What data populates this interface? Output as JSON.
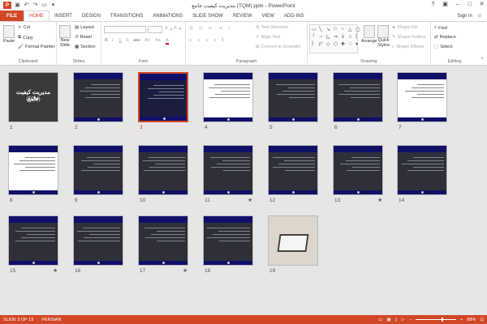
{
  "window": {
    "title": "مدیریت کیفیت جامع (TQM).pptx - PowerPoint"
  },
  "tabs": [
    "FILE",
    "HOME",
    "INSERT",
    "DESIGN",
    "TRANSITIONS",
    "ANIMATIONS",
    "SLIDE SHOW",
    "REVIEW",
    "VIEW",
    "ADD-INS"
  ],
  "active_tab": "HOME",
  "signin": "Sign in",
  "ribbon": {
    "clipboard": {
      "label": "Clipboard",
      "paste": "Paste",
      "cut": "Cut",
      "copy": "Copy",
      "format_painter": "Format Painter"
    },
    "slides": {
      "label": "Slides",
      "new_slide": "New",
      "new_slide2": "Slide",
      "layout": "Layout",
      "reset": "Reset",
      "section": "Section"
    },
    "font": {
      "label": "Font"
    },
    "paragraph": {
      "label": "Paragraph",
      "text_direction": "Text Direction",
      "align_text": "Align Text",
      "convert": "Convert to SmartArt"
    },
    "drawing": {
      "label": "Drawing",
      "arrange": "Arrange",
      "quick_styles": "Quick",
      "quick_styles2": "Styles",
      "shape_fill": "Shape Fill",
      "shape_outline": "Shape Outline",
      "shape_effects": "Shape Effects"
    },
    "editing": {
      "label": "Editing",
      "find": "Find",
      "replace": "Replace",
      "select": "Select"
    }
  },
  "slides": [
    {
      "num": "1",
      "title": "مدیریت کیفیت جامع",
      "subtitle": "(TQM)",
      "star": false
    },
    {
      "num": "2",
      "star": false
    },
    {
      "num": "3",
      "star": false,
      "selected": true
    },
    {
      "num": "4",
      "star": false
    },
    {
      "num": "5",
      "star": false
    },
    {
      "num": "6",
      "star": false
    },
    {
      "num": "7",
      "star": false
    },
    {
      "num": "8",
      "star": false
    },
    {
      "num": "9",
      "star": false
    },
    {
      "num": "10",
      "star": false
    },
    {
      "num": "11",
      "star": true
    },
    {
      "num": "12",
      "star": false
    },
    {
      "num": "13",
      "star": true
    },
    {
      "num": "14",
      "star": false
    },
    {
      "num": "15",
      "star": true
    },
    {
      "num": "16",
      "star": false
    },
    {
      "num": "17",
      "star": true
    },
    {
      "num": "18",
      "star": false
    },
    {
      "num": "19",
      "star": false
    }
  ],
  "status": {
    "slide": "SLIDE 3 OF 19",
    "language": "PERSIAN",
    "zoom": "68%",
    "zoom_minus": "−",
    "zoom_plus": "+"
  },
  "colors": {
    "accent": "#d24726",
    "slide_header": "#10106a"
  }
}
